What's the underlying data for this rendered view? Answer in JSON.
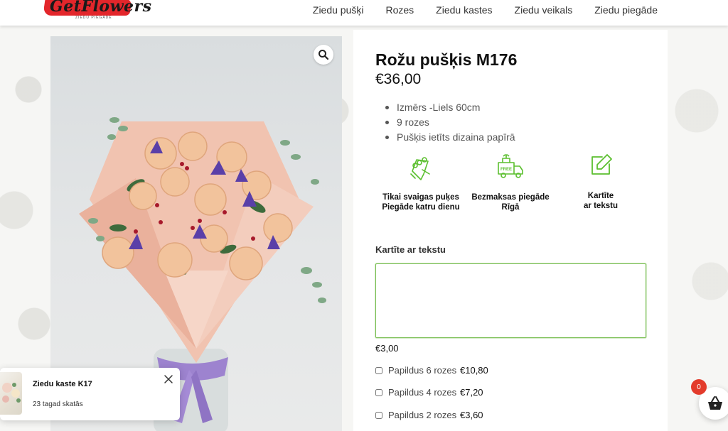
{
  "header": {
    "logo_text": "GetFlowers",
    "logo_sub": "ZIEDU PIEGĀDE",
    "nav": [
      "Ziedu pušķi",
      "Rozes",
      "Ziedu kastes",
      "Ziedu veikals",
      "Ziedu piegāde"
    ]
  },
  "product": {
    "title": "Rožu pušķis M176",
    "price": "€36,00",
    "features": [
      "Izmērs -Liels 60cm",
      "9 rozes",
      "Pušķis ietīts dizaina papīrā"
    ],
    "perks": [
      {
        "icon": "bouquet-icon",
        "label": "Tikai svaigas puķes\nPiegāde katru dienu"
      },
      {
        "icon": "free-delivery-truck-icon",
        "label": "Bezmaksas piegāde\nRīgā"
      },
      {
        "icon": "edit-card-icon",
        "label": "Kartīte\nar tekstu"
      }
    ],
    "card_heading": "Kartīte ar tekstu",
    "card_textarea_value": "",
    "card_price": "€3,00",
    "addons": [
      {
        "label": "Papildus 6 rozes",
        "price": "€10,80",
        "checked": false
      },
      {
        "label": "Papildus 4 rozes",
        "price": "€7,20",
        "checked": false
      },
      {
        "label": "Papildus 2 rozes",
        "price": "€3,60",
        "checked": false
      }
    ]
  },
  "popup": {
    "title": "Ziedu kaste K17",
    "subtitle": "23 tagad skatās"
  },
  "cart": {
    "count": "0"
  },
  "colors": {
    "accent_green": "#5bbf2f",
    "brand_red": "#e3262b",
    "badge_red": "#e33b2b"
  }
}
